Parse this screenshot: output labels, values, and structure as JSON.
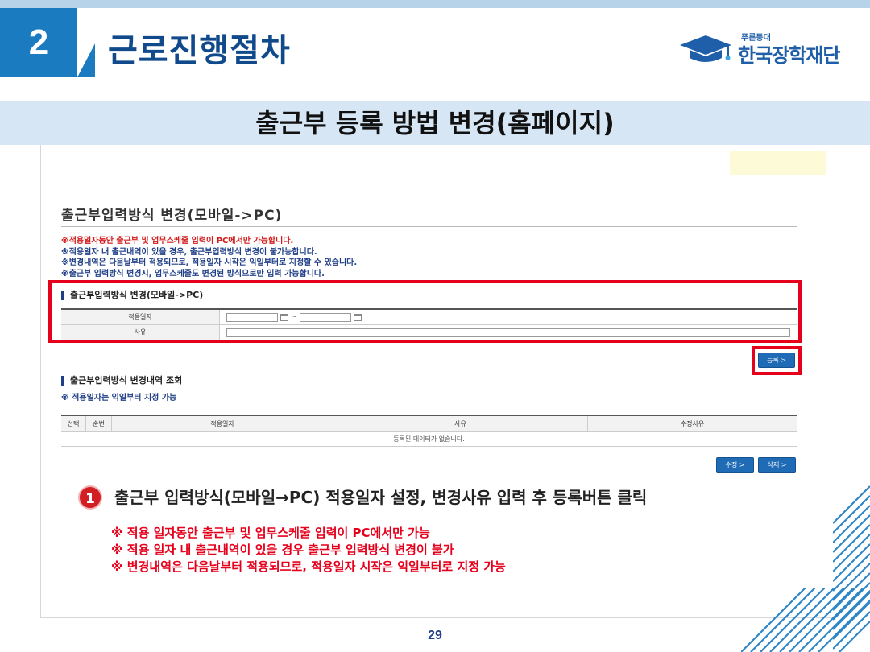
{
  "slide": {
    "section_number": "2",
    "section_title": "근로진행절차",
    "logo_small": "푸른등대",
    "logo_main": "한국장학재단",
    "banner_title": "출근부 등록 방법 변경(홈페이지)",
    "page_number": "29"
  },
  "screen": {
    "title": "출근부입력방식 변경(모바일->PC)",
    "notices": [
      "※적용일자동안 출근부 및 업무스케줄 입력이 PC에서만 가능합니다.",
      "※적용일자 내 출근내역이 있을 경우, 출근부입력방식 변경이 불가능합니다.",
      "※변경내역은 다음날부터 적용되므로, 적용일자 시작은 익일부터로 지정할 수 있습니다.",
      "※출근부 입력방식 변경시, 업무스케줄도 변경된 방식으로만 입력 가능합니다."
    ],
    "form": {
      "heading": "출근부입력방식 변경(모바일->PC)",
      "label_date": "적용일자",
      "date_separator": "~",
      "label_reason": "사유",
      "date_start_value": "",
      "date_end_value": "",
      "reason_value": ""
    },
    "register_button": "등록 >",
    "history": {
      "heading": "출근부입력방식 변경내역 조회",
      "note": "※ 적용일자는 익일부터 지정 가능",
      "columns": [
        "선택",
        "순번",
        "적용일자",
        "사유",
        "수정사유"
      ],
      "empty_message": "등록된 데이터가 없습니다."
    },
    "edit_button": "수정 >",
    "delete_button": "삭제 >"
  },
  "instructions": {
    "step_number": "1",
    "step_text": "출근부 입력방식(모바일→PC) 적용일자 설정, 변경사유 입력 후 등록버튼 클릭",
    "remarks": [
      "※ 적용 일자동안 출근부 및 업무스케줄 입력이 PC에서만 가능",
      "※ 적용 일자 내 출근내역이 있을 경우 출근부 입력방식 변경이 불가",
      "※ 변경내역은 다음날부터 적용되므로, 적용일자 시작은 익일부터로 지정 가능"
    ]
  },
  "colors": {
    "accent_blue": "#1b7bc0",
    "title_navy": "#114a8b",
    "highlight_red": "#e5001c",
    "banner_bg": "#d6e6f5"
  }
}
